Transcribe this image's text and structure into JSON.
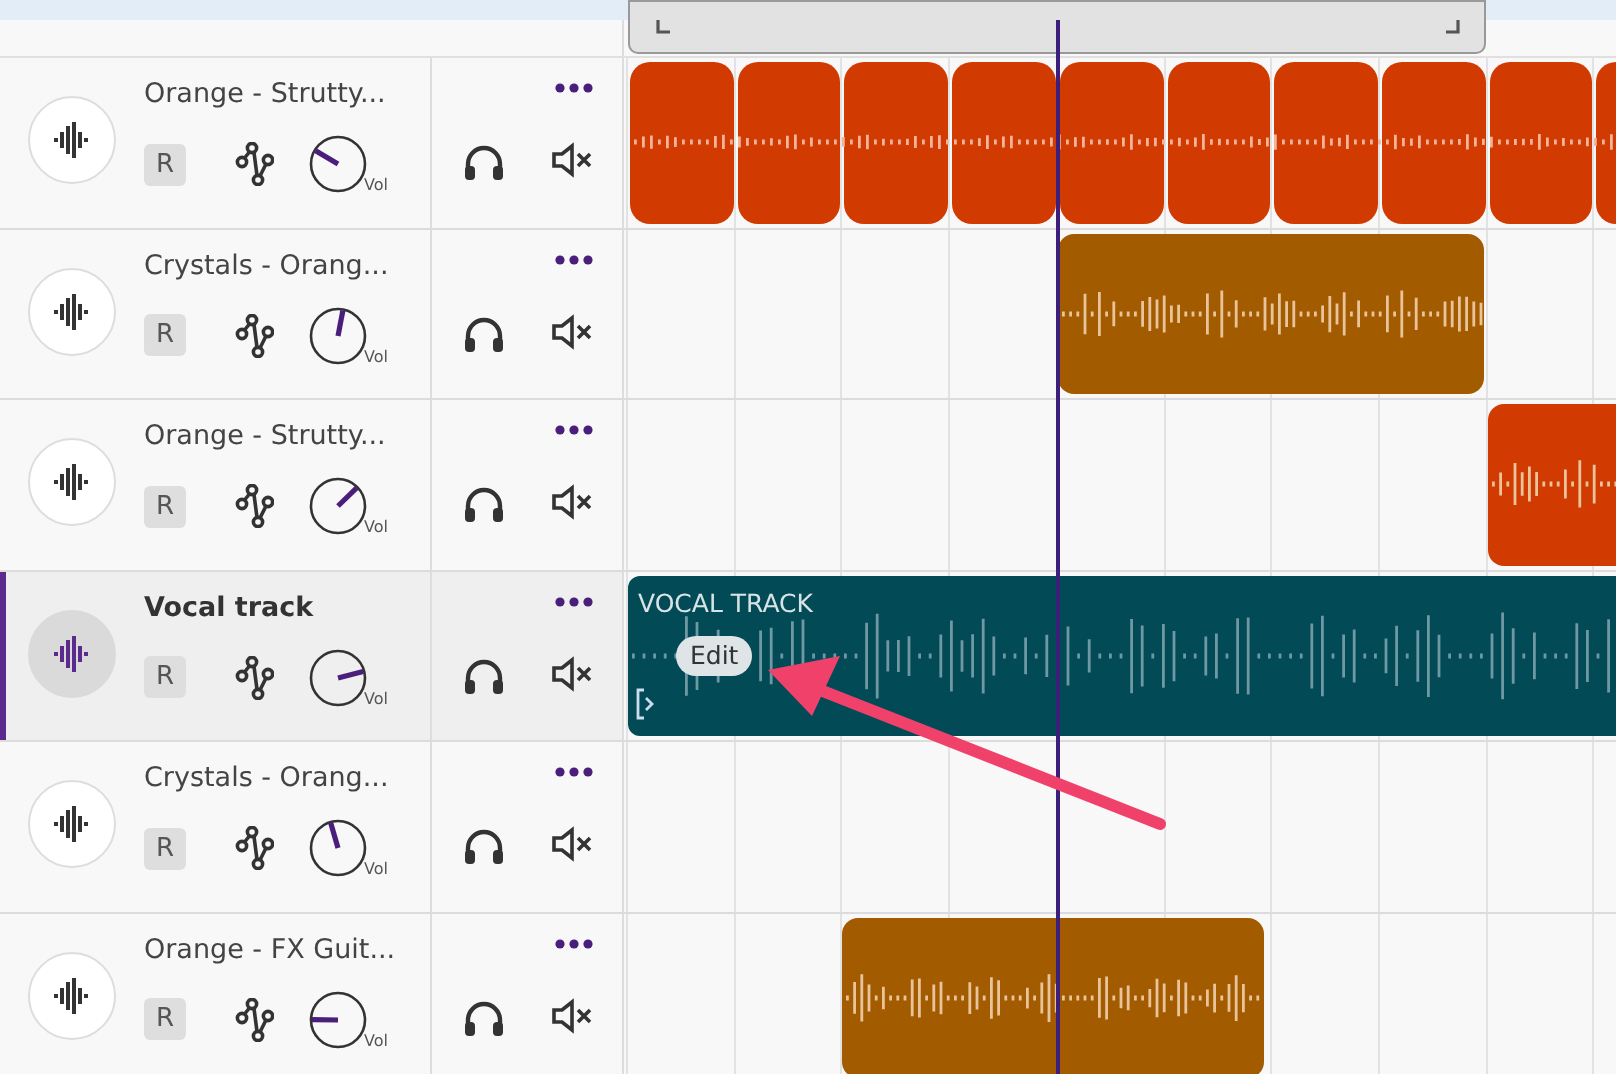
{
  "tracks": [
    {
      "name": "Orange - Strutty...",
      "selected": false,
      "record": "R",
      "volume": {
        "label": "Vol",
        "level": 0.28
      },
      "clips": [
        {
          "kind": "loop",
          "color": "#d13a00"
        }
      ]
    },
    {
      "name": "Crystals - Orang...",
      "selected": false,
      "record": "R",
      "volume": {
        "label": "Vol",
        "level": 0.54
      },
      "clips": [
        {
          "kind": "audio",
          "color": "#a35b00"
        }
      ]
    },
    {
      "name": "Orange - Strutty...",
      "selected": false,
      "record": "R",
      "volume": {
        "label": "Vol",
        "level": 0.67
      },
      "clips": [
        {
          "kind": "audio",
          "color": "#d13a00"
        }
      ]
    },
    {
      "name": "Vocal track",
      "selected": true,
      "record": "R",
      "volume": {
        "label": "Vol",
        "level": 0.78
      },
      "clips": [
        {
          "kind": "vocal",
          "color": "#034a57",
          "title": "VOCAL TRACK",
          "edit": "Edit"
        }
      ]
    },
    {
      "name": "Crystals - Orang...",
      "selected": false,
      "record": "R",
      "volume": {
        "label": "Vol",
        "level": 0.44
      }
    },
    {
      "name": "Orange - FX Guit...",
      "selected": false,
      "record": "R",
      "volume": {
        "label": "Vol",
        "level": 0.17
      },
      "clips": [
        {
          "kind": "audio",
          "color": "#a35b00"
        }
      ]
    }
  ]
}
